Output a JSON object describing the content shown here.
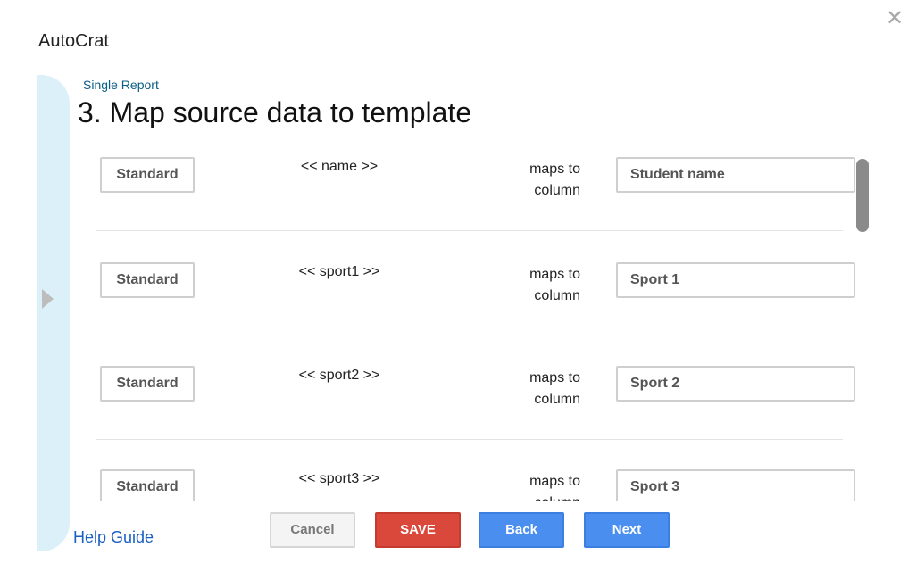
{
  "dialog": {
    "close_icon": "close-icon",
    "close_glyph": "✕",
    "app_title": "AutoCrat"
  },
  "header": {
    "subtitle": "Single Report",
    "title": "3. Map source data to template"
  },
  "mappings": [
    {
      "type_label": "Standard",
      "tag": "<< name >>",
      "maps_to": "maps to column",
      "column": "Student name"
    },
    {
      "type_label": "Standard",
      "tag": "<< sport1 >>",
      "maps_to": "maps to column",
      "column": "Sport 1"
    },
    {
      "type_label": "Standard",
      "tag": "<< sport2 >>",
      "maps_to": "maps to column",
      "column": "Sport 2"
    },
    {
      "type_label": "Standard",
      "tag": "<< sport3 >>",
      "maps_to": "maps to column",
      "column": "Sport 3"
    }
  ],
  "footer": {
    "help_label": "Help Guide",
    "cancel_label": "Cancel",
    "save_label": "SAVE",
    "back_label": "Back",
    "next_label": "Next"
  },
  "colors": {
    "rail": "#dcf0fa",
    "save": "#d9483b",
    "primary": "#4a8ff0",
    "link": "#1a5fc4",
    "subtitle": "#0b5e86"
  }
}
